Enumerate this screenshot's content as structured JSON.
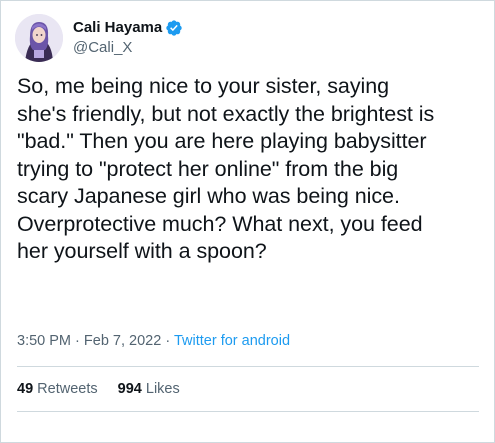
{
  "author": {
    "display_name": "Cali Hayama",
    "handle": "@Cali_X",
    "verified": true,
    "verified_color": "#1d9bf0",
    "avatar_icon": "profile-photo"
  },
  "tweet": {
    "text": "So, me being nice to your sister, saying\nshe's friendly, but not exactly the brightest is\n\"bad.\" Then you are here playing babysitter\ntrying to \"protect her online\" from the big\nscary Japanese girl who was being nice.\nOverprotective much? What next, you feed\nher yourself with a spoon?",
    "time": "3:50 PM",
    "separator": "·",
    "date": "Feb 7, 2022",
    "source": "Twitter for android"
  },
  "stats": {
    "retweets_count": "49",
    "retweets_label": "Retweets",
    "likes_count": "994",
    "likes_label": "Likes"
  }
}
